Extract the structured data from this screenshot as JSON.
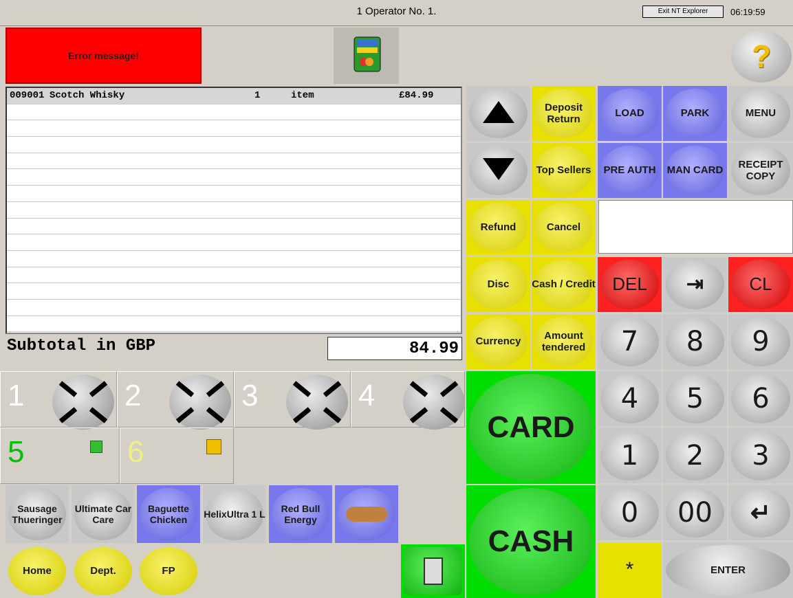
{
  "header": {
    "title": "1  Operator No. 1.",
    "exit_label": "Exit NT Explorer",
    "clock": "06:19:59"
  },
  "error": {
    "label": "Error message!"
  },
  "help": {
    "label": "?"
  },
  "items": [
    {
      "code": "009001",
      "name": "Scotch Whisky",
      "qty": "1",
      "unit": "item",
      "price": "£84.99"
    }
  ],
  "subtotal": {
    "label": "Subtotal in GBP",
    "value": "84.99"
  },
  "pumps": {
    "top": [
      "1",
      "2",
      "3",
      "4"
    ],
    "bottom": [
      "5",
      "6"
    ]
  },
  "function_keys": {
    "deposit": "Deposit Return",
    "load": "LOAD",
    "park": "PARK",
    "menu": "MENU",
    "top_sellers": "Top Sellers",
    "pre_auth": "PRE AUTH",
    "man_card": "MAN CARD",
    "receipt_copy": "RECEIPT COPY",
    "refund": "Refund",
    "cancel": "Cancel",
    "disc": "Disc",
    "cash_credit": "Cash / Credit",
    "currency": "Currency",
    "amount_tendered": "Amount tendered",
    "del": "DEL",
    "cl": "CL",
    "card": "CARD",
    "cash": "CASH",
    "enter": "ENTER",
    "star": "*"
  },
  "keypad": [
    "7",
    "8",
    "9",
    "4",
    "5",
    "6",
    "1",
    "2",
    "3",
    "0",
    "00"
  ],
  "products": [
    "Sausage Thueringer",
    "Ultimate Car Care",
    "Baguette Chicken",
    "HelixUltra 1 L",
    "Red Bull Energy"
  ],
  "nav": {
    "home": "Home",
    "dept": "Dept.",
    "fp": "FP"
  },
  "colors": {
    "yellow": "#e8e000",
    "blue": "#7777ee",
    "green": "#00dd00",
    "red": "#ff2020",
    "grey": "#d4d0c8"
  }
}
